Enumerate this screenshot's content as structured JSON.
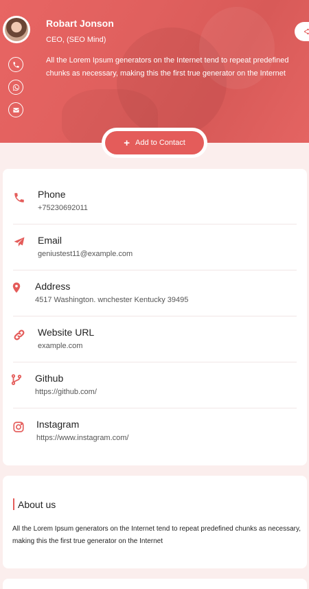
{
  "profile": {
    "name": "Robart Jonson",
    "title": "CEO, (SEO Mind)",
    "bio": "All the Lorem Ipsum generators on the Internet tend to repeat predefined chunks as necessary, making this the first true generator on the Internet"
  },
  "actions": {
    "add_contact": "Add to Contact"
  },
  "side_icons": [
    "phone-icon",
    "whatsapp-icon",
    "email-icon"
  ],
  "contacts": [
    {
      "label": "Phone",
      "value": "+75230692011",
      "icon": "phone-icon"
    },
    {
      "label": "Email",
      "value": "geniustest11@example.com",
      "icon": "paper-plane-icon"
    },
    {
      "label": "Address",
      "value": "4517 Washington. wnchester Kentucky 39495",
      "icon": "map-pin-icon"
    },
    {
      "label": "Website URL",
      "value": "example.com",
      "icon": "link-icon"
    },
    {
      "label": "Github",
      "value": "https://github.com/",
      "icon": "git-branch-icon"
    },
    {
      "label": "Instagram",
      "value": "https://www.instagram.com/",
      "icon": "instagram-icon"
    }
  ],
  "about": {
    "heading": "About us",
    "text": "All the Lorem Ipsum generators on the Internet tend to repeat predefined chunks as necessary, making this the first true generator on the Internet"
  },
  "colors": {
    "accent": "#e45c5a",
    "background": "#fbeeed",
    "hero": "#e0605e"
  }
}
